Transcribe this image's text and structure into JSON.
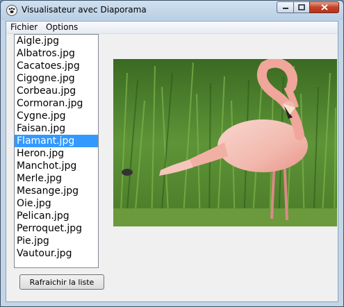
{
  "window": {
    "title": "Visualisateur avec Diaporama"
  },
  "menubar": {
    "items": [
      "Fichier",
      "Options"
    ]
  },
  "files": [
    "Aigle.jpg",
    "Albatros.jpg",
    "Cacatoes.jpg",
    "Cigogne.jpg",
    "Corbeau.jpg",
    "Cormoran.jpg",
    "Cygne.jpg",
    "Faisan.jpg",
    "Flamant.jpg",
    "Heron.jpg",
    "Manchot.jpg",
    "Merle.jpg",
    "Mesange.jpg",
    "Oie.jpg",
    "Pelican.jpg",
    "Perroquet.jpg",
    "Pie.jpg",
    "Vautour.jpg"
  ],
  "selected_index": 8,
  "buttons": {
    "refresh": "Rafraichir la liste"
  },
  "image": {
    "subject": "flamingo standing in green grass"
  },
  "colors": {
    "selection": "#3399ff",
    "close_button": "#c4432a"
  }
}
